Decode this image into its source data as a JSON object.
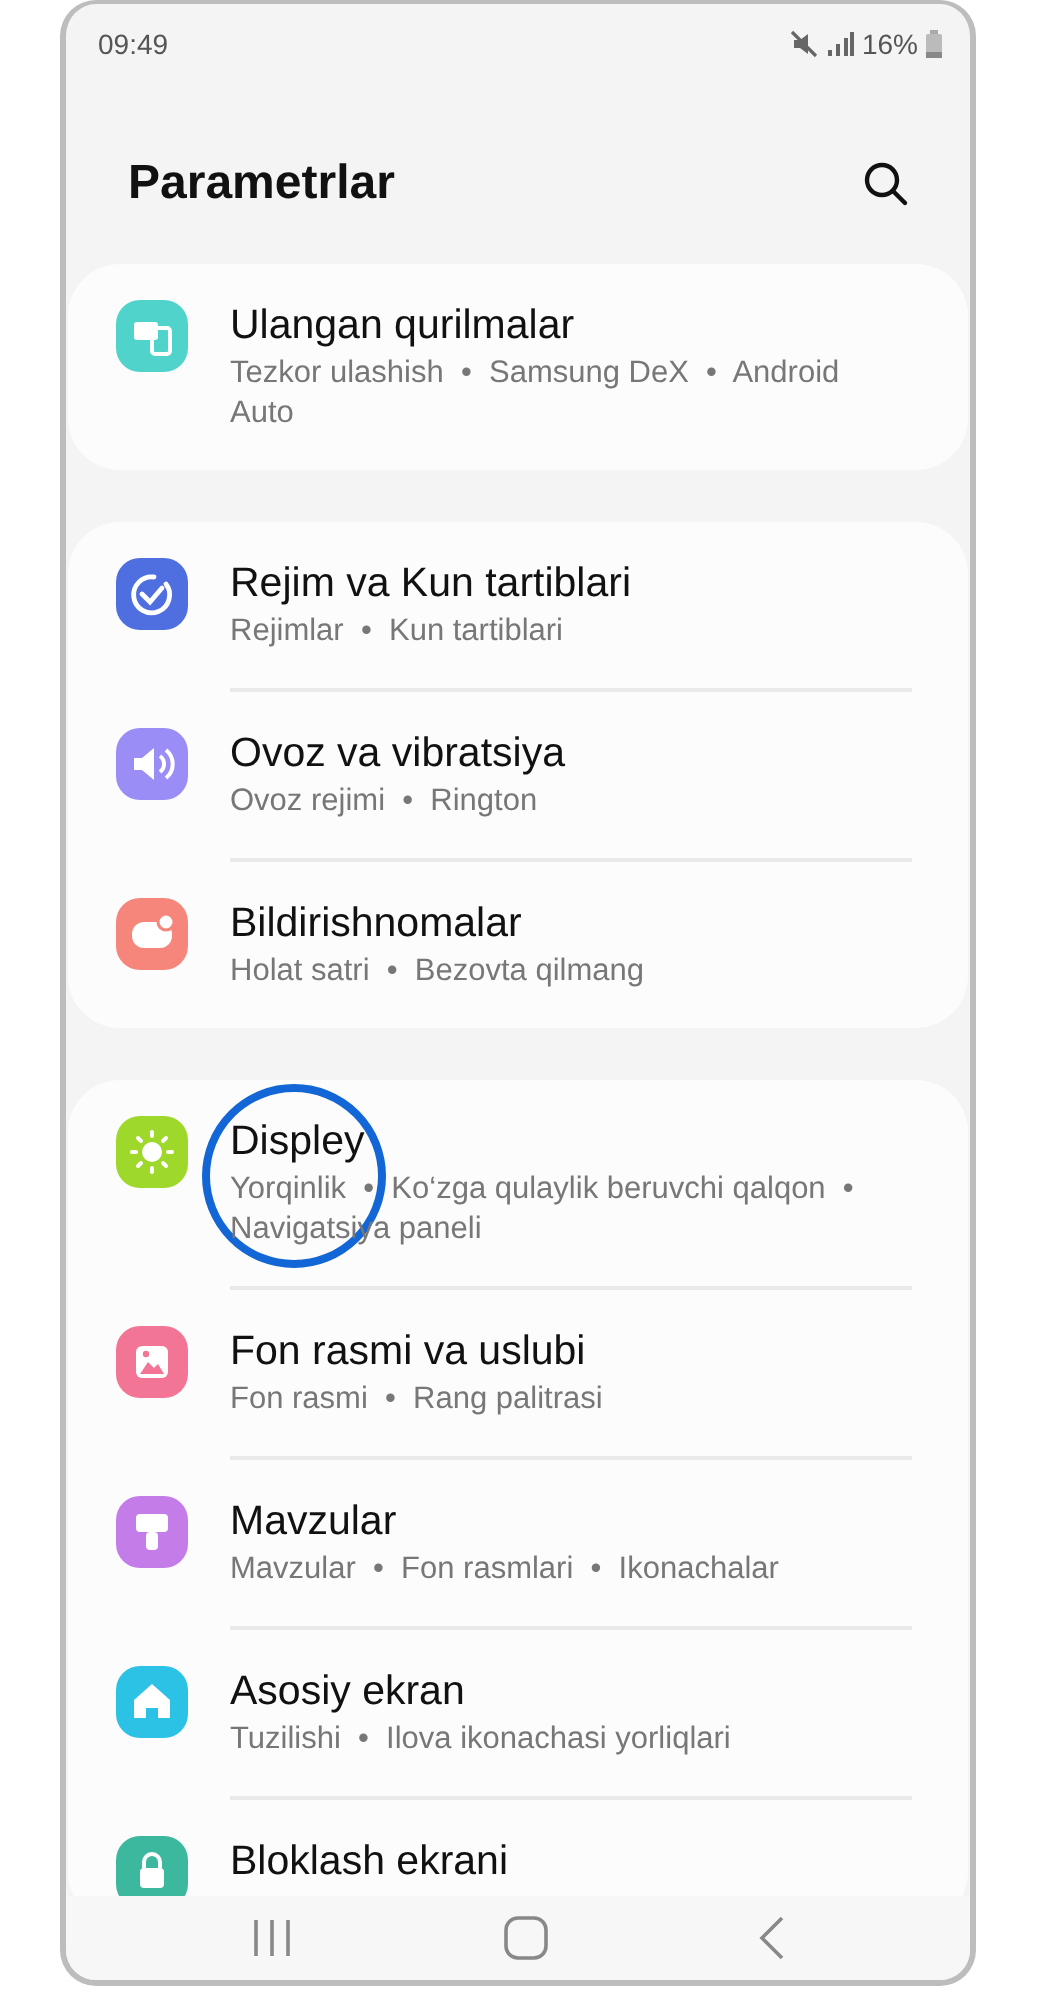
{
  "status_bar": {
    "time": "09:49",
    "battery": "16%"
  },
  "header": {
    "title": "Parametrlar"
  },
  "groups": [
    {
      "items": [
        {
          "title": "Ulangan qurilmalar",
          "subtitle": "Tezkor ulashish  •  Samsung DeX  •  Android Auto",
          "color": "#4fd3cb",
          "highlighted": false
        }
      ]
    },
    {
      "items": [
        {
          "title": "Rejim va Kun tartiblari",
          "subtitle": "Rejimlar  •  Kun tartiblari",
          "color": "#4f6fe0",
          "highlighted": false
        },
        {
          "title": "Ovoz va vibratsiya",
          "subtitle": "Ovoz rejimi  •  Rington",
          "color": "#9b8df6",
          "highlighted": false
        },
        {
          "title": "Bildirishnomalar",
          "subtitle": "Holat satri  •  Bezovta qilmang",
          "color": "#f6857b",
          "highlighted": false
        }
      ]
    },
    {
      "items": [
        {
          "title": "Displey",
          "subtitle": "Yorqinlik  •  Ko‘zga qulaylik beruvchi qalqon  •  Navigatsiya paneli",
          "color": "#9dd82a",
          "highlighted": true
        },
        {
          "title": "Fon rasmi va uslubi",
          "subtitle": "Fon rasmi  •  Rang palitrasi",
          "color": "#f27595",
          "highlighted": false
        },
        {
          "title": "Mavzular",
          "subtitle": "Mavzular  •  Fon rasmlari  •  Ikonachalar",
          "color": "#c47de8",
          "highlighted": false
        },
        {
          "title": "Asosiy ekran",
          "subtitle": "Tuzilishi  •  Ilova ikonachasi yorliqlari",
          "color": "#2cc2e6",
          "highlighted": false
        },
        {
          "title": "Bloklash ekrani",
          "color": "#3bb89d",
          "highlighted": false
        }
      ]
    }
  ]
}
